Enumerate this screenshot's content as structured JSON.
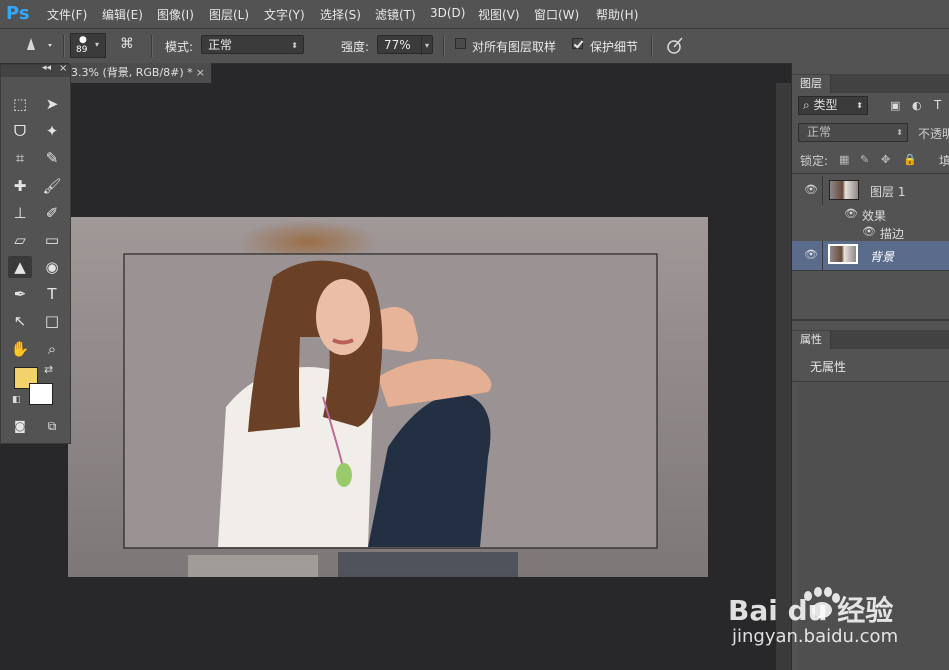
{
  "app": {
    "logo": "Ps"
  },
  "menu": [
    "文件(F)",
    "编辑(E)",
    "图像(I)",
    "图层(L)",
    "文字(Y)",
    "选择(S)",
    "滤镜(T)",
    "3D(D)",
    "视图(V)",
    "窗口(W)",
    "帮助(H)"
  ],
  "options": {
    "brush_size": "89",
    "mode_label": "模式:",
    "mode_value": "正常",
    "strength_label": "强度:",
    "strength_value": "77%",
    "sample_all_label": "对所有图层取样",
    "sample_all_checked": false,
    "protect_detail_label": "保护细节",
    "protect_detail_checked": true
  },
  "document": {
    "tab_title": "3.3% (背景, RGB/8#) *",
    "tab_close": "×"
  },
  "tools_panel": {
    "collapse": "◂◂",
    "close": "×"
  },
  "colors": {
    "foreground": "#f2d36b",
    "background": "#ffffff",
    "selected_layer": "#5a6b8c",
    "ps_blue": "#31a8ff"
  },
  "layers_panel": {
    "tab": "图层",
    "filter_label": "类型",
    "blend_mode": "正常",
    "opacity_label": "不透明",
    "lock_label": "锁定:",
    "fill_label": "填",
    "layers": [
      {
        "name": "图层 1",
        "visible": true,
        "selected": false
      },
      {
        "name": "效果",
        "visible": true,
        "sub": true
      },
      {
        "name": "描边",
        "visible": true,
        "sub": true
      },
      {
        "name": "背景",
        "visible": true,
        "selected": true
      }
    ]
  },
  "properties_panel": {
    "tab": "属性",
    "text": "无属性"
  },
  "watermark": {
    "brand": "Bai du 经验",
    "url": "jingyan.baidu.com"
  }
}
